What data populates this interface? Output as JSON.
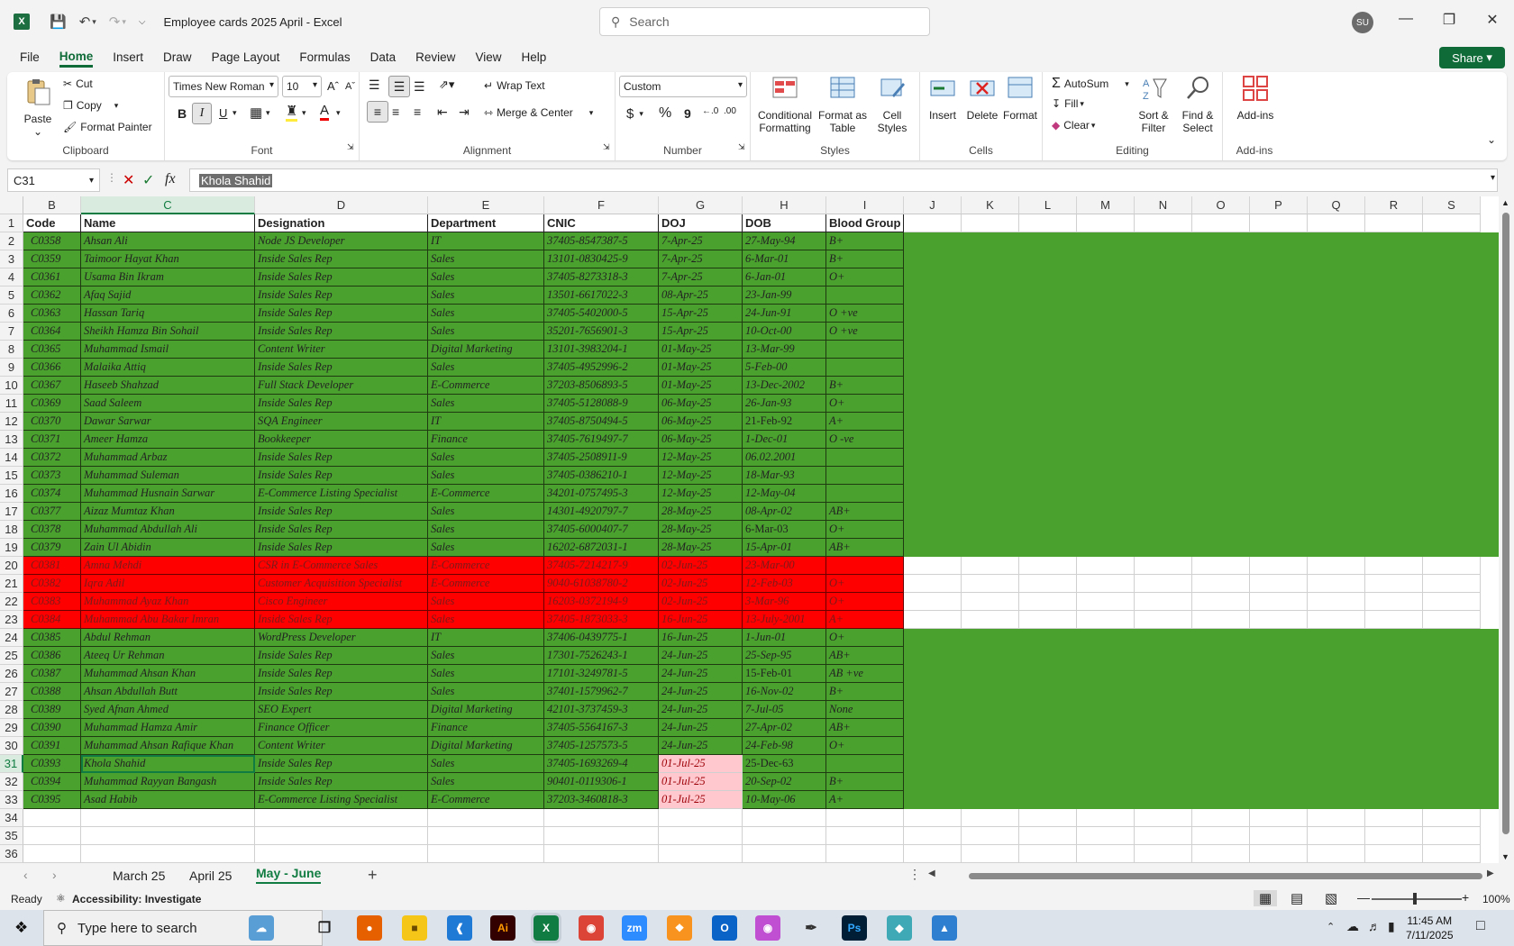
{
  "window": {
    "title": "Employee cards 2025 April  -  Excel",
    "search_placeholder": "Search",
    "user_initials": "SU"
  },
  "menu": [
    "File",
    "Home",
    "Insert",
    "Draw",
    "Page Layout",
    "Formulas",
    "Data",
    "Review",
    "View",
    "Help"
  ],
  "active_menu": "Home",
  "share_label": "Share",
  "ribbon": {
    "clipboard": {
      "paste": "Paste",
      "cut": "Cut",
      "copy": "Copy",
      "format_painter": "Format Painter",
      "label": "Clipboard"
    },
    "font": {
      "name": "Times New Roman",
      "size": "10",
      "label": "Font",
      "bold": "B",
      "italic": "I",
      "underline": "U"
    },
    "alignment": {
      "wrap": "Wrap Text",
      "merge": "Merge & Center",
      "label": "Alignment"
    },
    "number": {
      "format": "Custom",
      "label": "Number",
      "currency": "$",
      "percent": "%",
      "comma": "9"
    },
    "styles": {
      "conditional": "Conditional Formatting",
      "format_table": "Format as Table",
      "cell_styles": "Cell Styles",
      "label": "Styles"
    },
    "cells": {
      "insert": "Insert",
      "delete": "Delete",
      "format": "Format",
      "label": "Cells"
    },
    "editing": {
      "autosum": "AutoSum",
      "fill": "Fill",
      "clear": "Clear",
      "sort": "Sort & Filter",
      "find": "Find & Select",
      "label": "Editing"
    },
    "addins": {
      "addins": "Add-ins",
      "label": "Add-ins"
    }
  },
  "formula_bar": {
    "name_box": "C31",
    "fx": "fx",
    "value": "Khola Shahid"
  },
  "columns": [
    "B",
    "C",
    "D",
    "E",
    "F",
    "G",
    "H",
    "I",
    "J",
    "K",
    "L",
    "M",
    "N",
    "O",
    "P",
    "Q",
    "R",
    "S"
  ],
  "headers": [
    "Code",
    "Name",
    "Designation",
    "Department",
    "CNIC",
    "DOJ",
    "DOB",
    "Blood Group"
  ],
  "rows": [
    [
      "C0358",
      "Ahsan Ali",
      "Node JS Developer",
      "IT",
      "37405-8547387-5",
      "7-Apr-25",
      "27-May-94",
      "B+"
    ],
    [
      "C0359",
      "Taimoor Hayat Khan",
      "Inside Sales Rep",
      "Sales",
      "13101-0830425-9",
      "7-Apr-25",
      "6-Mar-01",
      "B+"
    ],
    [
      "C0361",
      "Usama Bin Ikram",
      "Inside Sales Rep",
      "Sales",
      "37405-8273318-3",
      "7-Apr-25",
      "6-Jan-01",
      "O+"
    ],
    [
      "C0362",
      "Afaq Sajid",
      "Inside Sales Rep",
      "Sales",
      "13501-6617022-3",
      "08-Apr-25",
      "23-Jan-99",
      ""
    ],
    [
      "C0363",
      "Hassan Tariq",
      "Inside Sales Rep",
      "Sales",
      "37405-5402000-5",
      "15-Apr-25",
      "24-Jun-91",
      "O +ve"
    ],
    [
      "C0364",
      "Sheikh Hamza Bin Sohail",
      "Inside Sales Rep",
      "Sales",
      "35201-7656901-3",
      "15-Apr-25",
      "10-Oct-00",
      "O +ve"
    ],
    [
      "C0365",
      "Muhammad Ismail",
      "Content Writer",
      "Digital Marketing",
      "13101-3983204-1",
      "01-May-25",
      "13-Mar-99",
      ""
    ],
    [
      "C0366",
      "Malaika Attiq",
      "Inside Sales Rep",
      "Sales",
      "37405-4952996-2",
      "01-May-25",
      "5-Feb-00",
      ""
    ],
    [
      "C0367",
      "Haseeb Shahzad",
      "Full Stack Developer",
      "E-Commerce",
      "37203-8506893-5",
      "01-May-25",
      "13-Dec-2002",
      "B+"
    ],
    [
      "C0369",
      "Saad Saleem",
      "Inside Sales Rep",
      "Sales",
      "37405-5128088-9",
      "06-May-25",
      "26-Jan-93",
      "O+"
    ],
    [
      "C0370",
      "Dawar Sarwar",
      "SQA Engineer",
      "IT",
      "37405-8750494-5",
      "06-May-25",
      "21-Feb-92",
      "A+"
    ],
    [
      "C0371",
      "Ameer Hamza",
      "Bookkeeper",
      "Finance",
      "37405-7619497-7",
      "06-May-25",
      "1-Dec-01",
      "O -ve"
    ],
    [
      "C0372",
      "Muhammad Arbaz",
      "Inside Sales Rep",
      "Sales",
      "37405-2508911-9",
      "12-May-25",
      "06.02.2001",
      ""
    ],
    [
      "C0373",
      "Muhammad Suleman",
      "Inside Sales Rep",
      "Sales",
      "37405-0386210-1",
      "12-May-25",
      "18-Mar-93",
      ""
    ],
    [
      "C0374",
      "Muhammad Husnain Sarwar",
      "E-Commerce Listing Specialist",
      "E-Commerce",
      "34201-0757495-3",
      "12-May-25",
      "12-May-04",
      ""
    ],
    [
      "C0377",
      "Aizaz Mumtaz Khan",
      "Inside Sales Rep",
      "Sales",
      "14301-4920797-7",
      "28-May-25",
      "08-Apr-02",
      "AB+"
    ],
    [
      "C0378",
      "Muhammad Abdullah Ali",
      "Inside Sales Rep",
      "Sales",
      "37405-6000407-7",
      "28-May-25",
      "6-Mar-03",
      "O+"
    ],
    [
      "C0379",
      "Zain Ul Abidin",
      "Inside Sales Rep",
      "Sales",
      "16202-6872031-1",
      "28-May-25",
      "15-Apr-01",
      "AB+"
    ],
    [
      "C0381",
      "Amna Mehdi",
      "CSR in E-Commerce Sales",
      "E-Commerce",
      "37405-7214217-9",
      "02-Jun-25",
      "23-Mar-00",
      ""
    ],
    [
      "C0382",
      "Iqra Adil",
      "Customer Acquisition Specialist",
      "E-Commerce",
      "9040-61038780-2",
      "02-Jun-25",
      "12-Feb-03",
      "O+"
    ],
    [
      "C0383",
      "Muhammad Ayaz Khan",
      "Cisco Engineer",
      "Sales",
      "16203-0372194-9",
      "02-Jun-25",
      "3-Mar-96",
      "O+"
    ],
    [
      "C0384",
      "Muhammad Abu Bakar Imran",
      "Inside Sales Rep",
      "Sales",
      "37405-1873033-3",
      "16-Jun-25",
      "13-July-2001",
      "A+"
    ],
    [
      "C0385",
      "Abdul Rehman",
      "WordPress Developer",
      "IT",
      "37406-0439775-1",
      "16-Jun-25",
      "1-Jun-01",
      "O+"
    ],
    [
      "C0386",
      "Ateeq Ur Rehman",
      "Inside Sales Rep",
      "Sales",
      "17301-7526243-1",
      "24-Jun-25",
      "25-Sep-95",
      "AB+"
    ],
    [
      "C0387",
      "Muhammad Ahsan Khan",
      "Inside Sales Rep",
      "Sales",
      "17101-3249781-5",
      "24-Jun-25",
      "15-Feb-01",
      "AB +ve"
    ],
    [
      "C0388",
      "Ahsan Abdullah Butt",
      "Inside Sales Rep",
      "Sales",
      "37401-1579962-7",
      "24-Jun-25",
      "16-Nov-02",
      "B+"
    ],
    [
      "C0389",
      "Syed Afnan Ahmed",
      "SEO Expert",
      "Digital Marketing",
      "42101-3737459-3",
      "24-Jun-25",
      "7-Jul-05",
      "None"
    ],
    [
      "C0390",
      "Muhammad Hamza Amir",
      "Finance Officer",
      "Finance",
      "37405-5564167-3",
      "24-Jun-25",
      "27-Apr-02",
      "AB+"
    ],
    [
      "C0391",
      "Muhammad Ahsan Rafique Khan",
      "Content Writer",
      "Digital Marketing",
      "37405-1257573-5",
      "24-Jun-25",
      "24-Feb-98",
      "O+"
    ],
    [
      "C0393",
      "Khola Shahid",
      "Inside Sales Rep",
      "Sales",
      "37405-1693269-4",
      "01-Jul-25",
      "25-Dec-63",
      ""
    ],
    [
      "C0394",
      "Muhammad Rayyan Bangash",
      "Inside Sales Rep",
      "Sales",
      "90401-0119306-1",
      "01-Jul-25",
      "20-Sep-02",
      "B+"
    ],
    [
      "C0395",
      "Asad Habib",
      "E-Commerce Listing Specialist",
      "E-Commerce",
      "37203-3460818-3",
      "01-Jul-25",
      "10-May-06",
      "A+"
    ]
  ],
  "red_rows": [
    20,
    21,
    22,
    23
  ],
  "pink_doj_rows": [
    31,
    32,
    33
  ],
  "selected_cell": "C31",
  "empty_rows": [
    "34",
    "35",
    "36"
  ],
  "sheet_tabs": [
    "March 25",
    "April 25",
    "May - June"
  ],
  "active_sheet": "May - June",
  "status": {
    "ready": "Ready",
    "accessibility": "Accessibility: Investigate",
    "zoom": "100%"
  },
  "taskbar": {
    "search_placeholder": "Type here to search",
    "time": "11:45 AM",
    "date": "7/11/2025"
  },
  "colors": {
    "green": "#4aa12e",
    "red": "#fe0000",
    "pink": "#ffc7ce",
    "excel": "#107c41"
  }
}
